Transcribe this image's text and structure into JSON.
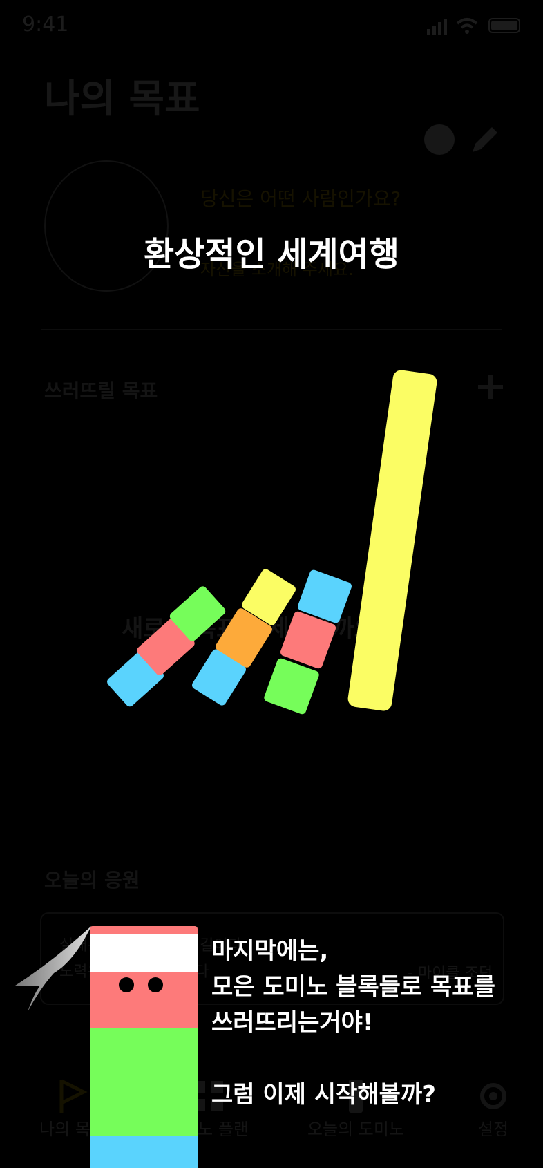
{
  "status_bar": {
    "time": "9:41"
  },
  "background": {
    "page_title": "나의 목표",
    "identity_question": "당신은 어떤 사람인가요?",
    "identity_hint": "자신을 소개해 주세요.",
    "section_goals": "쓰러뜨릴 목표",
    "empty_goal_prompt": "새로운 목표를 세워볼까요?",
    "section_cheer": "오늘의 응원",
    "cheer_line1": "실패는 성공으로 가는 길이다",
    "cheer_line2": "노력은 배신하지 않는다",
    "cheer_author": "- 마이클 조던",
    "tabs": [
      "나의 목표",
      "도미노 플랜",
      "오늘의 도미노",
      "설정"
    ]
  },
  "overlay": {
    "headline": "환상적인 세계여행",
    "message_lines": "마지막에는,\n모은 도미노 블록들로 목표를\n쓰러뜨리는거야!\n\n그럼 이제 시작해볼까?"
  },
  "colors": {
    "yellow": "#FBFD64",
    "blue": "#5AD3FD",
    "pink": "#FD7A7A",
    "green": "#76FD5A",
    "orange": "#FDAA3A",
    "white": "#FFFFFF"
  }
}
